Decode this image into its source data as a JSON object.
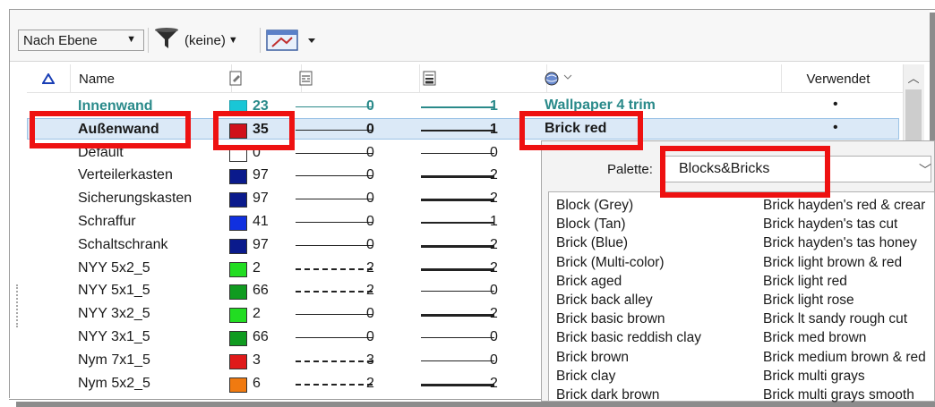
{
  "toolbar": {
    "group_by": "Nach Ebene",
    "filter_label": "(keine)"
  },
  "header": {
    "name": "Name",
    "used": "Verwendet"
  },
  "rows": [
    {
      "name": "Innenwand",
      "color": "#19c6d6",
      "color_num": "23",
      "linestyle": "solid",
      "linestyle_num": "0",
      "line_weight": "1",
      "material": "Wallpaper 4 trim",
      "used": "•",
      "style": "teal"
    },
    {
      "name": "Außenwand",
      "color": "#d0101a",
      "color_num": "35",
      "linestyle": "solid",
      "linestyle_num": "0",
      "line_weight": "1",
      "material": "Brick red",
      "used": "•",
      "style": "selected"
    },
    {
      "name": "Default",
      "color": "#ffffff",
      "color_num": "0",
      "linestyle": "solid",
      "linestyle_num": "0",
      "line_weight": "0",
      "material": "",
      "used": "",
      "style": "normal"
    },
    {
      "name": "Verteilerkasten",
      "color": "#0a1a8c",
      "color_num": "97",
      "linestyle": "solid",
      "linestyle_num": "0",
      "line_weight": "2",
      "material": "",
      "used": "",
      "style": "normal"
    },
    {
      "name": "Sicherungskasten",
      "color": "#0a1a8c",
      "color_num": "97",
      "linestyle": "solid",
      "linestyle_num": "0",
      "line_weight": "2",
      "material": "",
      "used": "",
      "style": "normal"
    },
    {
      "name": "Schraffur",
      "color": "#1030e0",
      "color_num": "41",
      "linestyle": "solid",
      "linestyle_num": "0",
      "line_weight": "1",
      "material": "",
      "used": "",
      "style": "normal"
    },
    {
      "name": "Schaltschrank",
      "color": "#0a1a8c",
      "color_num": "97",
      "linestyle": "solid",
      "linestyle_num": "0",
      "line_weight": "2",
      "material": "",
      "used": "",
      "style": "normal"
    },
    {
      "name": "NYY 5x2_5",
      "color": "#22dd22",
      "color_num": "2",
      "linestyle": "dashed",
      "linestyle_num": "2",
      "line_weight": "2",
      "material": "",
      "used": "",
      "style": "normal"
    },
    {
      "name": "NYY 5x1_5",
      "color": "#109b20",
      "color_num": "66",
      "linestyle": "dashed",
      "linestyle_num": "2",
      "line_weight": "0",
      "material": "",
      "used": "",
      "style": "normal"
    },
    {
      "name": "NYY 3x2_5",
      "color": "#22dd22",
      "color_num": "2",
      "linestyle": "solid",
      "linestyle_num": "0",
      "line_weight": "2",
      "material": "",
      "used": "",
      "style": "normal"
    },
    {
      "name": "NYY 3x1_5",
      "color": "#109b20",
      "color_num": "66",
      "linestyle": "solid",
      "linestyle_num": "0",
      "line_weight": "0",
      "material": "",
      "used": "",
      "style": "normal"
    },
    {
      "name": "Nym 7x1_5",
      "color": "#e01a1a",
      "color_num": "3",
      "linestyle": "longdash",
      "linestyle_num": "3",
      "line_weight": "0",
      "material": "",
      "used": "",
      "style": "normal"
    },
    {
      "name": "Nym 5x2_5",
      "color": "#f07a10",
      "color_num": "6",
      "linestyle": "dashed",
      "linestyle_num": "2",
      "line_weight": "2",
      "material": "",
      "used": "",
      "style": "normal"
    }
  ],
  "popup": {
    "palette_label": "Palette:",
    "palette_value": "Blocks&Bricks",
    "col1": [
      "Block (Grey)",
      "Block (Tan)",
      "Brick (Blue)",
      "Brick (Multi-color)",
      "Brick aged",
      "Brick back alley",
      "Brick basic brown",
      "Brick basic reddish clay",
      "Brick brown",
      "Brick clay",
      "Brick dark brown"
    ],
    "col2": [
      "Brick hayden's red & crear",
      "Brick hayden's tas cut",
      "Brick hayden's tas honey",
      "Brick light brown & red",
      "Brick light red",
      "Brick light rose",
      "Brick lt sandy rough cut",
      "Brick med brown",
      "Brick medium brown & red",
      "Brick multi grays",
      "Brick multi grays smooth"
    ]
  },
  "colors": {
    "highlight_red": "#ee1111",
    "selection_bg": "#dbe9f7",
    "teal_text": "#2a8a8a"
  }
}
